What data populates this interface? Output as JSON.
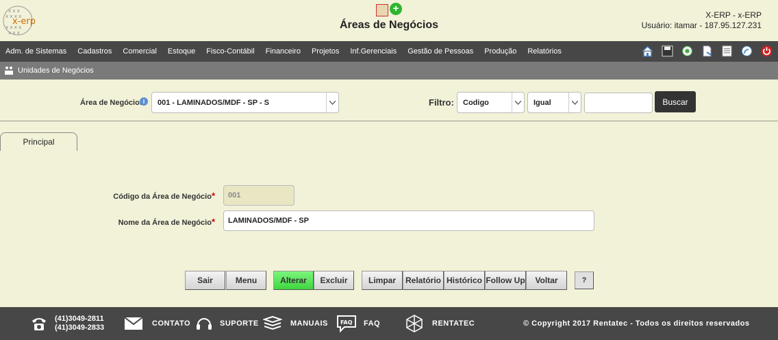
{
  "header": {
    "logo_text": "x-erp",
    "title": "Áreas de Negócios",
    "user_line1": "X-ERP - x-ERP",
    "user_line2": "Usuário: itamar - 187.95.127.231"
  },
  "menu": {
    "items": [
      "Adm. de Sistemas",
      "Cadastros",
      "Comercial",
      "Estoque",
      "Fisco-Contábil",
      "Financeiro",
      "Projetos",
      "Inf.Gerenciais",
      "Gestão de Pessoas",
      "Produção",
      "Relatórios"
    ],
    "icons": [
      "home-icon",
      "save-icon",
      "tool-icon",
      "document-icon",
      "list-icon",
      "rss-icon",
      "power-icon"
    ]
  },
  "breadcrumb": {
    "label": "Unidades de Negócios"
  },
  "filter": {
    "area_label": "Área de Negócios",
    "area_value": "001 - LAMINADOS/MDF - SP - S",
    "filtro_label": "Filtro:",
    "field_value": "Codigo",
    "operator_value": "Igual",
    "search_value": "",
    "search_button": "Buscar"
  },
  "tabs": {
    "principal": "Principal"
  },
  "form": {
    "codigo_label": "Código da Área de Negócio",
    "codigo_value": "001",
    "nome_label": "Nome da Área de Negócio",
    "nome_value": "LAMINADOS/MDF - SP",
    "required_mark": "*"
  },
  "buttons": {
    "sair": "Sair",
    "menu": "Menu",
    "alterar": "Alterar",
    "excluir": "Excluir",
    "limpar": "Limpar",
    "relatorio": "Relatório",
    "historico": "Histórico",
    "followup": "Follow Up",
    "voltar": "Voltar",
    "help": "?"
  },
  "footer": {
    "phone1": "(41)3049-2811",
    "phone2": "(41)3049-2833",
    "contato": "CONTATO",
    "suporte": "SUPORTE",
    "manuais": "MANUAIS",
    "faq": "FAQ",
    "rentatec": "RENTATEC",
    "copyright": "© Copyright 2017 Rentatec - Todos os direitos reservados"
  },
  "colors": {
    "background": "#f2f2d9",
    "menubar": "#474747",
    "breadcrumb": "#7a7a7a",
    "accent_green": "#4fe04f"
  }
}
